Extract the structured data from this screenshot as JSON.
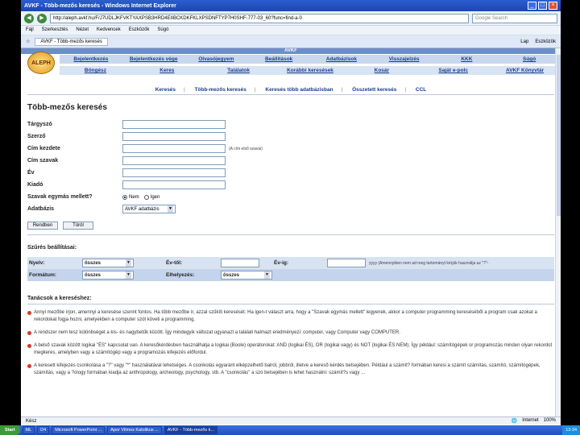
{
  "window": {
    "title": "AVKF - Több-mezős keresés - Windows Internet Explorer"
  },
  "address": {
    "url": "http://aleph.avkf.hu/F/J7UDLJKFVKTYAXPSB3HRD4EIIBCKDKFKLXPSDNFTYP7H0SHF-777-03_60?func=find-a-0",
    "search_placeholder": "Google Search"
  },
  "menu": [
    "Fájl",
    "Szerkesztés",
    "Nézet",
    "Kedvencek",
    "Eszközök",
    "Súgó"
  ],
  "tab": {
    "label": "AVKF - Több-mezős keresés",
    "tools": [
      "Lap",
      "Eszközök"
    ]
  },
  "header": {
    "band": "AVKF",
    "logo": "ALEPH",
    "row1": [
      "Bejelentkezés",
      "Bejelentkezés vége",
      "Olvasójegyem",
      "Beállítások",
      "Adatbázisok",
      "Visszajelzés",
      "KKK",
      "Súgó"
    ],
    "row2": [
      "Böngész",
      "Keres",
      "Találatok",
      "Korábbi keresések",
      "Kosár",
      "Saját e-polc",
      "AVKF Könyvtár"
    ]
  },
  "subnav": [
    "Keresés",
    "Több-mezős keresés",
    "Keresés több adatbázisban",
    "Összetett keresés",
    "CCL"
  ],
  "page_title": "Több-mezős keresés",
  "form": {
    "fields": [
      "Tárgyszó",
      "Szerző",
      "Cím kezdete",
      "Cím szavak",
      "Év",
      "Kiadó"
    ],
    "title_hint": "(A cím első szavai)",
    "adjacency_label": "Szavak egymás mellett?",
    "adjacency_no": "Nem",
    "adjacency_yes": "Igen",
    "database_label": "Adatbázis",
    "database_value": "AVKF adatbázis",
    "ok_button": "Rendben",
    "clear_button": "Töröl"
  },
  "filters": {
    "title": "Szűrés beállításai:",
    "language_label": "Nyelv:",
    "language_value": "összes",
    "year_from_label": "Év-től:",
    "year_to_label": "Év-ig:",
    "year_hint": "yyyy (Amennyiben nem ad meg tartományt kérjük használja az \"?\"-",
    "format_label": "Formátum:",
    "format_value": "összes",
    "location_label": "Elhelyezés:",
    "location_value": "összes"
  },
  "tips": {
    "title": "Tanácsok a kereséshez:",
    "items": [
      "Annyi mezőbe írjon, amennyi a keresése szerint fontos. Ha több mezőbe ír, azzal szűkíti keresését. Ha igen-t választ arra, hogy a \"Szavak egymás mellett\" legyenek, akkor a computer programming kereséséből a program csak azokat a rekordokat fogja hozni, amelyekben a computer szót követi a programming.",
      "A rendszer nem tesz különbséget a kis- és nagybetűk között. Így mindegyik változat ugyanazt a találati halmazt eredményezi: computer, vagy Computer vagy COMPUTER.",
      "A belső szavak között logikai \"ÉS\" kapcsolat van. A keresőkérdésben használhatja a logikai (Boole) operátorokat: AND (logikai ÉS), OR (logikai vagy) és NOT (logikai ÉS NEM). Így például: számítógépek or programozás minden olyan rekordot megkeres, amelyben vagy a számítógép vagy a programozás kifejezés előfordul.",
      "A keresett kifejezés csonkolása a \"?\" vagy \"*\" használatával lehetséges. A csonkolás egyaránt elképzelhető balról, jobbról, illetve a kereső kérdés belsejében. Például a számít? formában keresi a számít számítás, számító, számítógépek, számítás, vagy a ?ology formában kiadja az anthropology, archeology, psychology, stb. A \"csonkolás\" a szó belsejében is lehet használni: számít?s vagy ..."
    ]
  },
  "status": {
    "left": "Kész",
    "zone": "Internet",
    "zoom": "100%"
  },
  "taskbar": {
    "start": "Start",
    "items": [
      "ML",
      "D4",
      "Microsoft PowerPoint ...",
      "Apor Vilmos Katolikus ...",
      "AVKF - Több-mezős k..."
    ],
    "clock": "13:34"
  }
}
